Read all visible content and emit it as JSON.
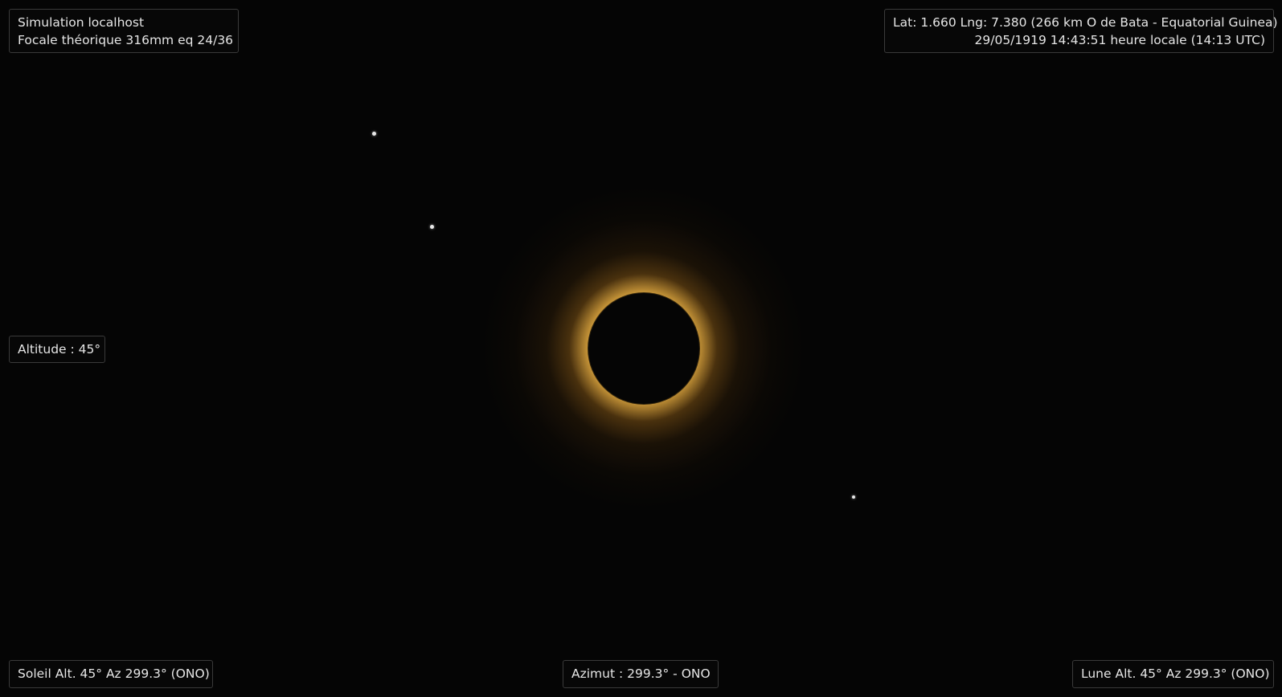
{
  "top_left": {
    "line1": "Simulation localhost",
    "line2": "Focale théorique 316mm eq 24/36"
  },
  "top_right": {
    "line1": "Lat: 1.660 Lng: 7.380 (266 km O de Bata - Equatorial Guinea)",
    "line2": "29/05/1919 14:43:51 heure locale (14:13 UTC)"
  },
  "altitude": "Altitude : 45°",
  "sun": "Soleil Alt. 45° Az 299.3° (ONO)",
  "azimuth": "Azimut : 299.3° - ONO",
  "moon": "Lune Alt. 45° Az 299.3° (ONO)",
  "colors": {
    "sky": "#050505",
    "corona": "#ffbe46",
    "panel_border": "#3a3a3a",
    "text": "#e6e6e6"
  }
}
